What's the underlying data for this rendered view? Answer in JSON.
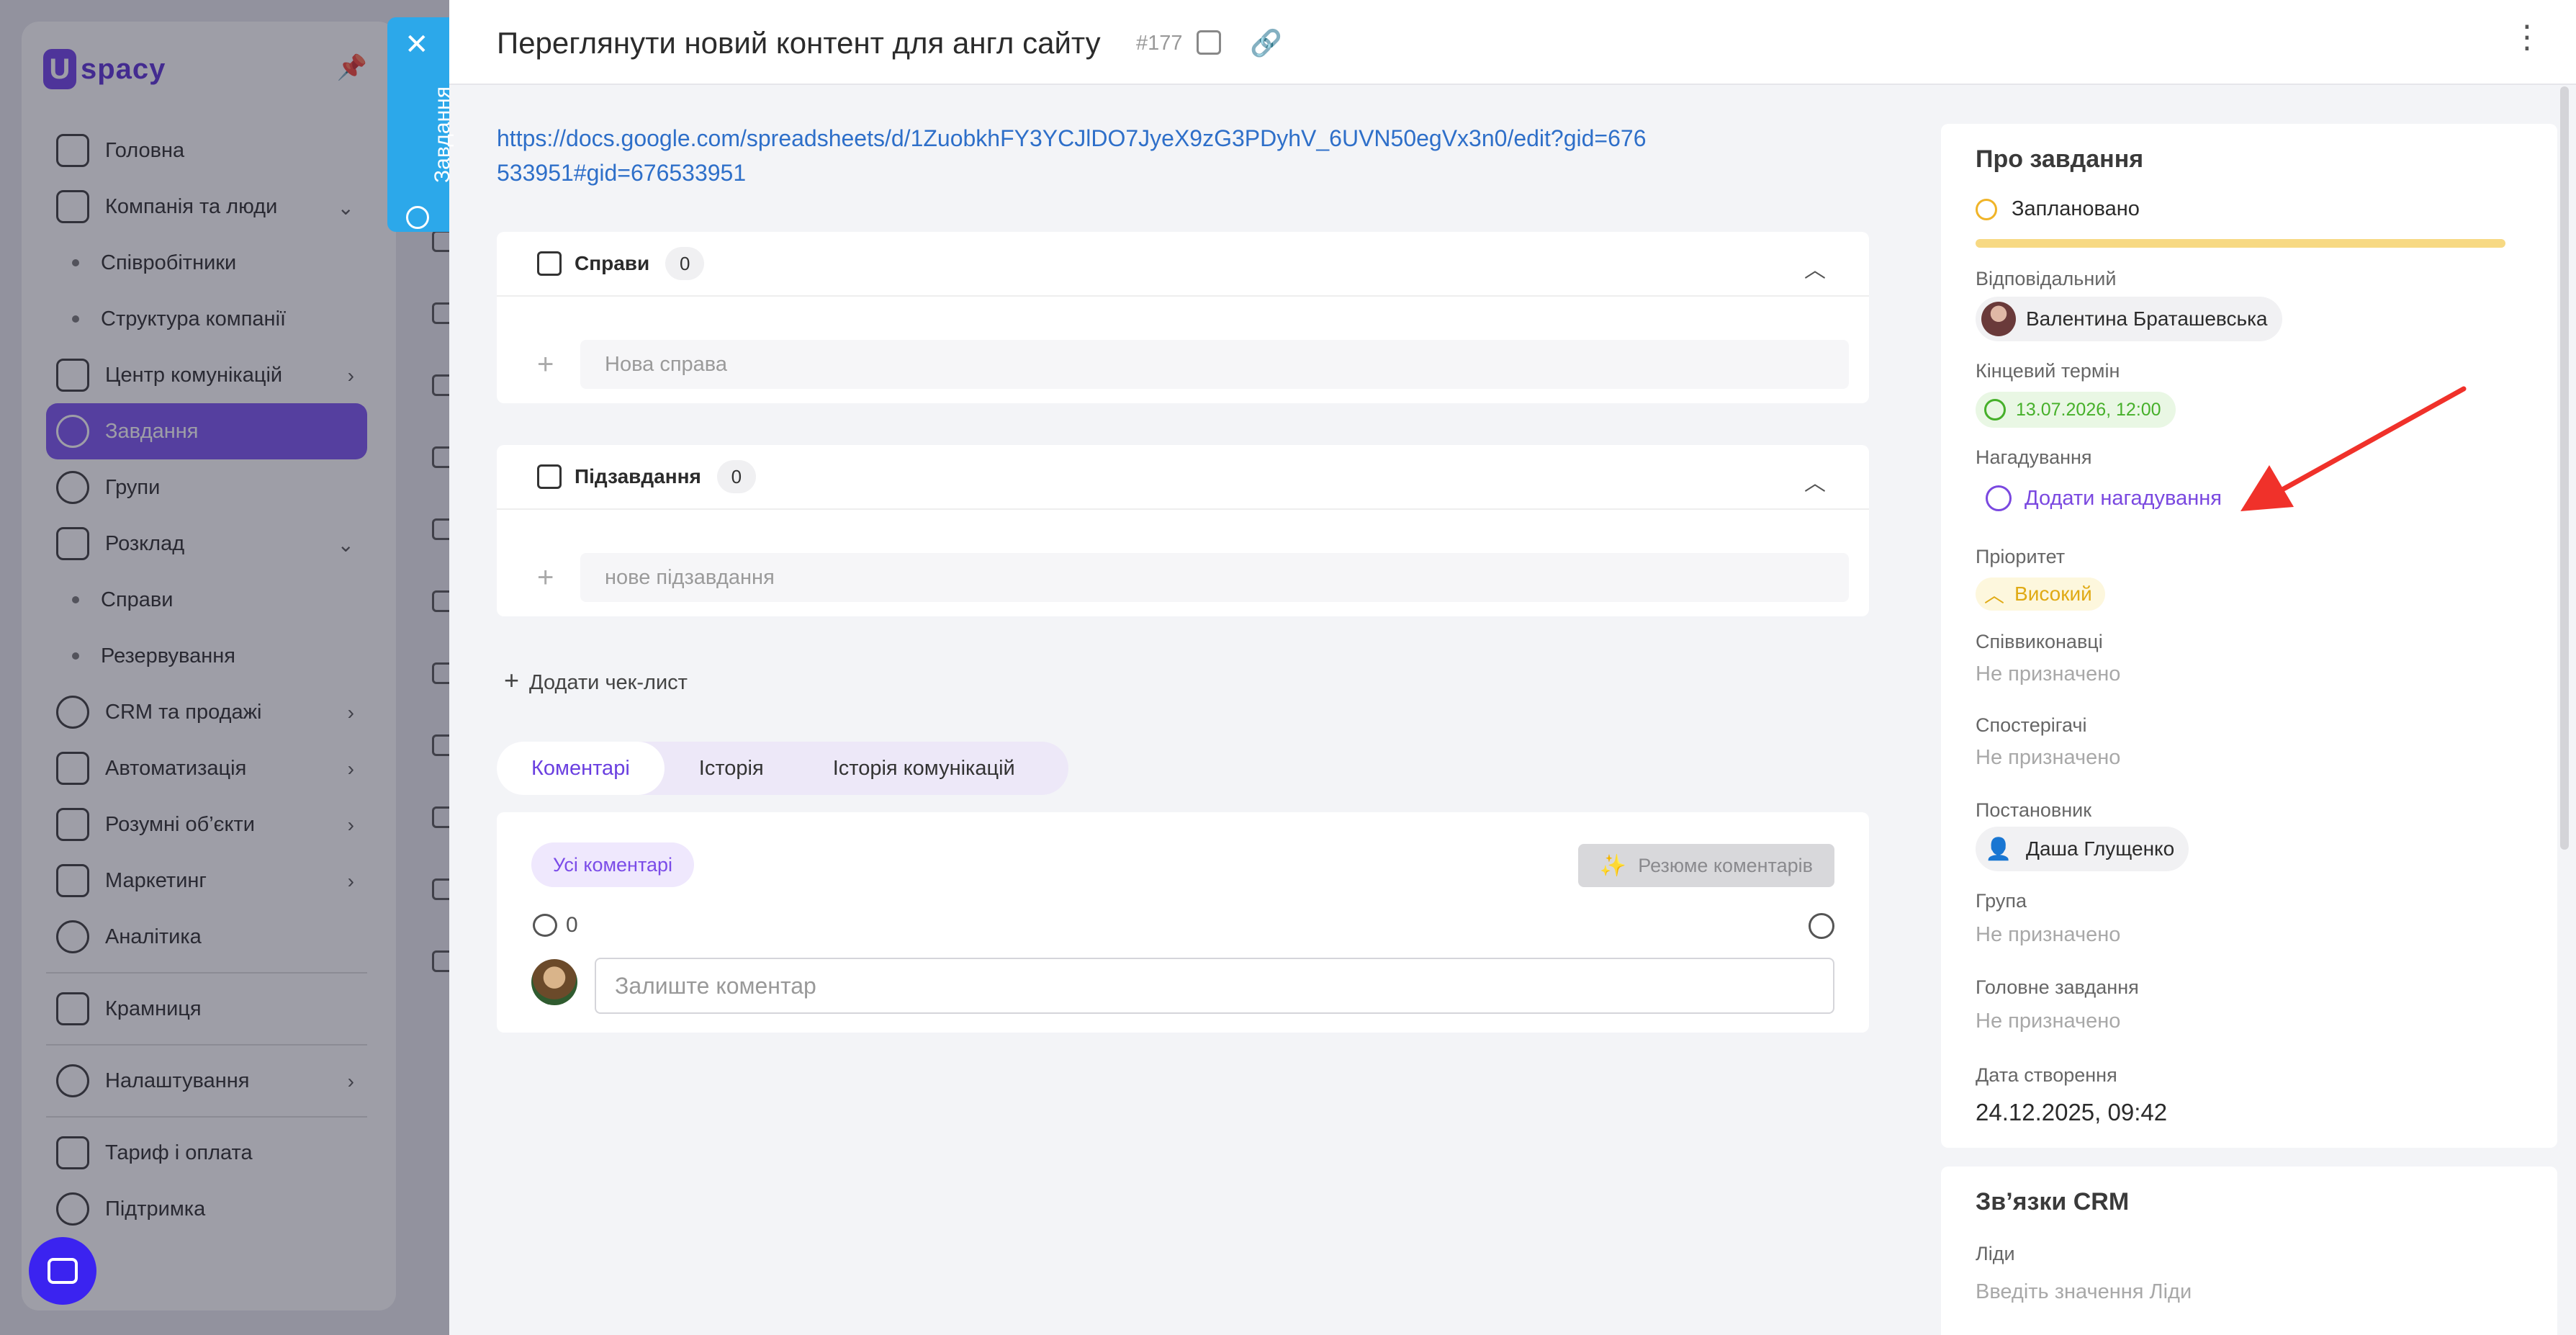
{
  "sidebar": {
    "logo_text": "spacy",
    "items": [
      {
        "label": "Головна"
      },
      {
        "label": "Компанія та люди"
      },
      {
        "label": "Співробітники"
      },
      {
        "label": "Структура компанії"
      },
      {
        "label": "Центр комунікацій"
      },
      {
        "label": "Завдання"
      },
      {
        "label": "Групи"
      },
      {
        "label": "Розклад"
      },
      {
        "label": "Справи"
      },
      {
        "label": "Резервування"
      },
      {
        "label": "CRM та продажі"
      },
      {
        "label": "Автоматизація"
      },
      {
        "label": "Розумні об’єкти"
      },
      {
        "label": "Маркетинг"
      },
      {
        "label": "Аналітика"
      },
      {
        "label": "Крамниця"
      },
      {
        "label": "Налаштування"
      },
      {
        "label": "Тариф і оплата"
      },
      {
        "label": "Підтримка"
      }
    ]
  },
  "side_tab": {
    "label": "Завдання"
  },
  "task": {
    "title": "Переглянути новий контент для англ сайту",
    "number": "#177",
    "url": "https://docs.google.com/spreadsheets/d/1ZuobkhFY3YCJlDO7JyeX9zG3PDyhV_6UVN50egVx3n0/edit?gid=676533951#gid=676533951"
  },
  "cases": {
    "title": "Справи",
    "count": "0",
    "placeholder": "Нова справа"
  },
  "subtasks": {
    "title": "Підзавдання",
    "count": "0",
    "placeholder": "нове підзавдання"
  },
  "add_checklist": "Додати чек-лист",
  "tabs": [
    {
      "label": "Коментарі",
      "active": true
    },
    {
      "label": "Історія"
    },
    {
      "label": "Історія комунікацій"
    }
  ],
  "comments": {
    "filter": "Усі коментарі",
    "summary_button": "Резюме коментарів",
    "count": "0",
    "placeholder": "Залиште коментар"
  },
  "about": {
    "title": "Про завдання",
    "status": "Заплановано",
    "responsible_label": "Відповідальний",
    "responsible": "Валентина Браташевська",
    "deadline_label": "Кінцевий термін",
    "deadline": "13.07.2026, 12:00",
    "reminder_label": "Нагадування",
    "reminder_action": "Додати нагадування",
    "priority_label": "Пріоритет",
    "priority": "Високий",
    "coexecutors_label": "Співвиконавці",
    "coexecutors": "Не призначено",
    "observers_label": "Спостерігачі",
    "observers": "Не призначено",
    "creator_label": "Постановник",
    "creator": "Даша Глущенко",
    "group_label": "Група",
    "group": "Не призначено",
    "parent_label": "Головне завдання",
    "parent": "Не призначено",
    "created_label": "Дата створення",
    "created": "24.12.2025, 09:42"
  },
  "crm": {
    "title": "Зв’язки CRM",
    "leads_label": "Ліди",
    "leads_placeholder": "Введіть значення Ліди"
  },
  "colors": {
    "accent": "#7b52f0",
    "side_tab": "#2ca8ea",
    "status_planned": "#f0b428",
    "deadline_green": "#46b02a",
    "priority_high": "#e0aa14",
    "annotation_arrow": "#f0312a"
  }
}
